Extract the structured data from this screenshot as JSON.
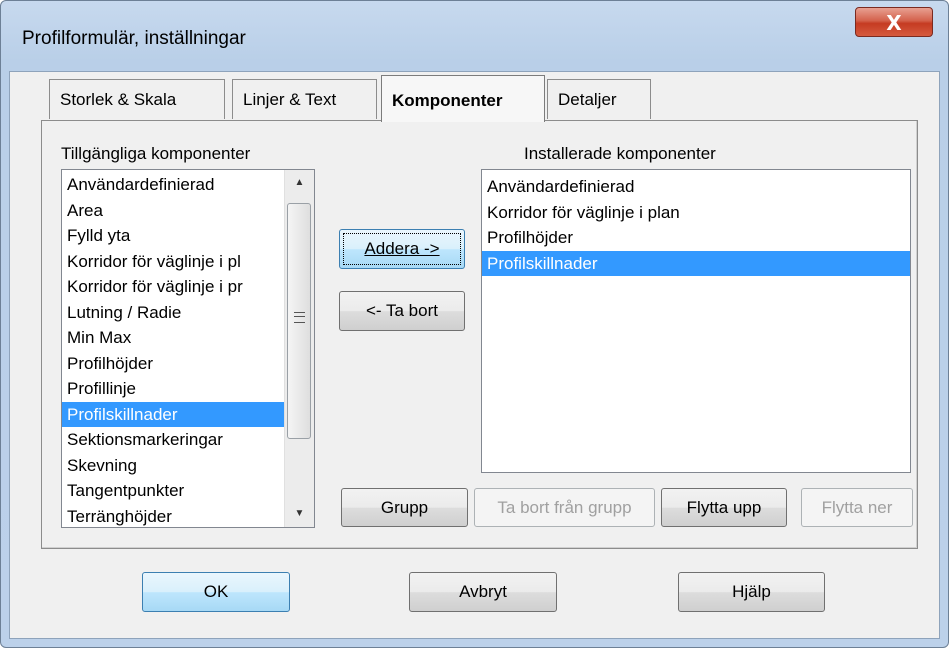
{
  "window": {
    "title": "Profilformulär, inställningar",
    "close_label": "X"
  },
  "tabs": [
    {
      "label": "Storlek & Skala",
      "active": false
    },
    {
      "label": "Linjer & Text",
      "active": false
    },
    {
      "label": "Komponenter",
      "active": true
    },
    {
      "label": "Detaljer",
      "active": false
    }
  ],
  "available": {
    "label": "Tillgängliga komponenter",
    "items": [
      "Användardefinierad",
      "Area",
      "Fylld yta",
      "Korridor för väglinje i pl",
      "Korridor för väglinje i pr",
      "Lutning / Radie",
      "Min Max",
      "Profilhöjder",
      "Profillinje",
      "Profilskillnader",
      "Sektionsmarkeringar",
      "Skevning",
      "Tangentpunkter",
      "Terränghöjder"
    ],
    "selected_index": 9
  },
  "installed": {
    "label": "Installerade komponenter",
    "items": [
      "Användardefinierad",
      "Korridor för väglinje i plan",
      "Profilhöjder",
      "Profilskillnader"
    ],
    "selected_index": 3
  },
  "buttons": {
    "add": "Addera ->",
    "remove": "<- Ta bort",
    "group": "Grupp",
    "remove_from_group": "Ta bort från grupp",
    "move_up": "Flytta upp",
    "move_down": "Flytta ner",
    "ok": "OK",
    "cancel": "Avbryt",
    "help": "Hjälp"
  },
  "colors": {
    "selection": "#3399ff",
    "close_button": "#c53b22",
    "frame": "#bcd1ea"
  }
}
